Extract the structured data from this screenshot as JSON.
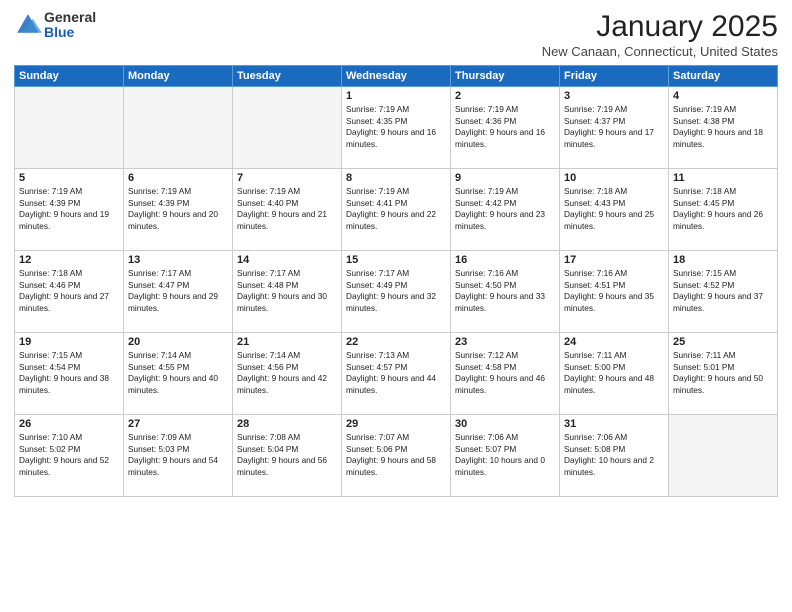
{
  "logo": {
    "general": "General",
    "blue": "Blue"
  },
  "header": {
    "month": "January 2025",
    "location": "New Canaan, Connecticut, United States"
  },
  "weekdays": [
    "Sunday",
    "Monday",
    "Tuesday",
    "Wednesday",
    "Thursday",
    "Friday",
    "Saturday"
  ],
  "weeks": [
    [
      {
        "day": "",
        "empty": true
      },
      {
        "day": "",
        "empty": true
      },
      {
        "day": "",
        "empty": true
      },
      {
        "day": "1",
        "sunrise": "7:19 AM",
        "sunset": "4:35 PM",
        "daylight": "9 hours and 16 minutes."
      },
      {
        "day": "2",
        "sunrise": "7:19 AM",
        "sunset": "4:36 PM",
        "daylight": "9 hours and 16 minutes."
      },
      {
        "day": "3",
        "sunrise": "7:19 AM",
        "sunset": "4:37 PM",
        "daylight": "9 hours and 17 minutes."
      },
      {
        "day": "4",
        "sunrise": "7:19 AM",
        "sunset": "4:38 PM",
        "daylight": "9 hours and 18 minutes."
      }
    ],
    [
      {
        "day": "5",
        "sunrise": "7:19 AM",
        "sunset": "4:39 PM",
        "daylight": "9 hours and 19 minutes."
      },
      {
        "day": "6",
        "sunrise": "7:19 AM",
        "sunset": "4:39 PM",
        "daylight": "9 hours and 20 minutes."
      },
      {
        "day": "7",
        "sunrise": "7:19 AM",
        "sunset": "4:40 PM",
        "daylight": "9 hours and 21 minutes."
      },
      {
        "day": "8",
        "sunrise": "7:19 AM",
        "sunset": "4:41 PM",
        "daylight": "9 hours and 22 minutes."
      },
      {
        "day": "9",
        "sunrise": "7:19 AM",
        "sunset": "4:42 PM",
        "daylight": "9 hours and 23 minutes."
      },
      {
        "day": "10",
        "sunrise": "7:18 AM",
        "sunset": "4:43 PM",
        "daylight": "9 hours and 25 minutes."
      },
      {
        "day": "11",
        "sunrise": "7:18 AM",
        "sunset": "4:45 PM",
        "daylight": "9 hours and 26 minutes."
      }
    ],
    [
      {
        "day": "12",
        "sunrise": "7:18 AM",
        "sunset": "4:46 PM",
        "daylight": "9 hours and 27 minutes."
      },
      {
        "day": "13",
        "sunrise": "7:17 AM",
        "sunset": "4:47 PM",
        "daylight": "9 hours and 29 minutes."
      },
      {
        "day": "14",
        "sunrise": "7:17 AM",
        "sunset": "4:48 PM",
        "daylight": "9 hours and 30 minutes."
      },
      {
        "day": "15",
        "sunrise": "7:17 AM",
        "sunset": "4:49 PM",
        "daylight": "9 hours and 32 minutes."
      },
      {
        "day": "16",
        "sunrise": "7:16 AM",
        "sunset": "4:50 PM",
        "daylight": "9 hours and 33 minutes."
      },
      {
        "day": "17",
        "sunrise": "7:16 AM",
        "sunset": "4:51 PM",
        "daylight": "9 hours and 35 minutes."
      },
      {
        "day": "18",
        "sunrise": "7:15 AM",
        "sunset": "4:52 PM",
        "daylight": "9 hours and 37 minutes."
      }
    ],
    [
      {
        "day": "19",
        "sunrise": "7:15 AM",
        "sunset": "4:54 PM",
        "daylight": "9 hours and 38 minutes."
      },
      {
        "day": "20",
        "sunrise": "7:14 AM",
        "sunset": "4:55 PM",
        "daylight": "9 hours and 40 minutes."
      },
      {
        "day": "21",
        "sunrise": "7:14 AM",
        "sunset": "4:56 PM",
        "daylight": "9 hours and 42 minutes."
      },
      {
        "day": "22",
        "sunrise": "7:13 AM",
        "sunset": "4:57 PM",
        "daylight": "9 hours and 44 minutes."
      },
      {
        "day": "23",
        "sunrise": "7:12 AM",
        "sunset": "4:58 PM",
        "daylight": "9 hours and 46 minutes."
      },
      {
        "day": "24",
        "sunrise": "7:11 AM",
        "sunset": "5:00 PM",
        "daylight": "9 hours and 48 minutes."
      },
      {
        "day": "25",
        "sunrise": "7:11 AM",
        "sunset": "5:01 PM",
        "daylight": "9 hours and 50 minutes."
      }
    ],
    [
      {
        "day": "26",
        "sunrise": "7:10 AM",
        "sunset": "5:02 PM",
        "daylight": "9 hours and 52 minutes."
      },
      {
        "day": "27",
        "sunrise": "7:09 AM",
        "sunset": "5:03 PM",
        "daylight": "9 hours and 54 minutes."
      },
      {
        "day": "28",
        "sunrise": "7:08 AM",
        "sunset": "5:04 PM",
        "daylight": "9 hours and 56 minutes."
      },
      {
        "day": "29",
        "sunrise": "7:07 AM",
        "sunset": "5:06 PM",
        "daylight": "9 hours and 58 minutes."
      },
      {
        "day": "30",
        "sunrise": "7:06 AM",
        "sunset": "5:07 PM",
        "daylight": "10 hours and 0 minutes."
      },
      {
        "day": "31",
        "sunrise": "7:06 AM",
        "sunset": "5:08 PM",
        "daylight": "10 hours and 2 minutes."
      },
      {
        "day": "",
        "empty": true
      }
    ]
  ]
}
